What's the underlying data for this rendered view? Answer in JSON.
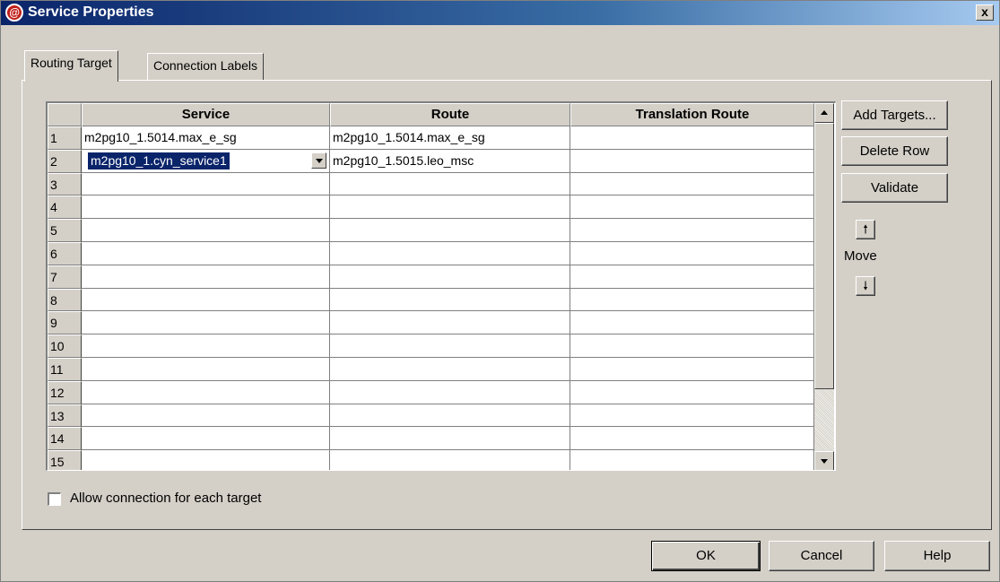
{
  "window": {
    "title": "Service Properties",
    "close_label": "x"
  },
  "tabs": [
    {
      "label": "Routing Target",
      "active": true
    },
    {
      "label": "Connection Labels",
      "active": false
    }
  ],
  "grid": {
    "columns": [
      "",
      "Service",
      "Route",
      "Translation Route"
    ],
    "rows": [
      {
        "num": "1",
        "service": "m2pg10_1.5014.max_e_sg",
        "route": "m2pg10_1.5014.max_e_sg",
        "translation": ""
      },
      {
        "num": "2",
        "service": "m2pg10_1.cyn_service1",
        "route": "m2pg10_1.5015.leo_msc",
        "translation": ""
      },
      {
        "num": "3",
        "service": "",
        "route": "",
        "translation": ""
      },
      {
        "num": "4",
        "service": "",
        "route": "",
        "translation": ""
      },
      {
        "num": "5",
        "service": "",
        "route": "",
        "translation": ""
      },
      {
        "num": "6",
        "service": "",
        "route": "",
        "translation": ""
      },
      {
        "num": "7",
        "service": "",
        "route": "",
        "translation": ""
      },
      {
        "num": "8",
        "service": "",
        "route": "",
        "translation": ""
      },
      {
        "num": "9",
        "service": "",
        "route": "",
        "translation": ""
      },
      {
        "num": "10",
        "service": "",
        "route": "",
        "translation": ""
      },
      {
        "num": "11",
        "service": "",
        "route": "",
        "translation": ""
      },
      {
        "num": "12",
        "service": "",
        "route": "",
        "translation": ""
      },
      {
        "num": "13",
        "service": "",
        "route": "",
        "translation": ""
      },
      {
        "num": "14",
        "service": "",
        "route": "",
        "translation": ""
      },
      {
        "num": "15",
        "service": "",
        "route": "",
        "translation": ""
      }
    ]
  },
  "side_buttons": {
    "add_targets": "Add Targets...",
    "delete_row": "Delete Row",
    "validate": "Validate",
    "move_label": "Move"
  },
  "checkbox": {
    "label": "Allow connection for each target",
    "checked": false
  },
  "footer": {
    "ok": "OK",
    "cancel": "Cancel",
    "help": "Help"
  },
  "colors": {
    "title_start": "#0a246a",
    "title_end": "#a6caf0",
    "face": "#d4d0c8",
    "selection": "#0a246a"
  }
}
